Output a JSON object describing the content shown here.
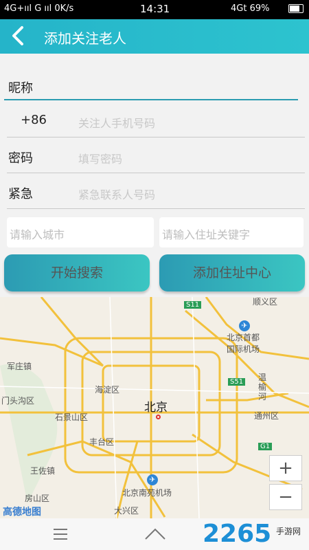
{
  "status": {
    "left": "4G+ııl  G ııl 0K/s",
    "time": "14:31",
    "right": "4Gt 69%"
  },
  "header": {
    "title": "添加关注老人"
  },
  "form": {
    "nickname": "昵称",
    "phone": {
      "label": "+86",
      "placeholder": "关注人手机号码"
    },
    "password": {
      "label": "密码",
      "placeholder": "填写密码"
    },
    "emergency": {
      "label": "紧急",
      "placeholder": "紧急联系人号码"
    },
    "city_placeholder": "请输入城市",
    "address_placeholder": "请输入住址关键字",
    "search_label": "开始搜索",
    "add_label": "添加住址中心"
  },
  "map": {
    "center_label": "北京",
    "labels": {
      "shunyi": "顺义区",
      "airport": "北京首都\n国际机场",
      "junzhuang": "军庄镇",
      "mentougou": "门头沟区",
      "haidian": "海淀区",
      "shijingshan": "石景山区",
      "fengtai": "丰台区",
      "tongzhou": "通州区",
      "wenyu": "温榆河",
      "wangzuo": "王佐镇",
      "nanyuan": "北京南苑机场",
      "fangshan": "房山区",
      "daxing": "大兴区",
      "logo": "高德地图",
      "s11": "S11",
      "s51": "S51",
      "g1": "G1"
    },
    "zoom_in": "+",
    "zoom_out": "−"
  },
  "watermark": {
    "number": "2265",
    "suffix": "手游网"
  }
}
